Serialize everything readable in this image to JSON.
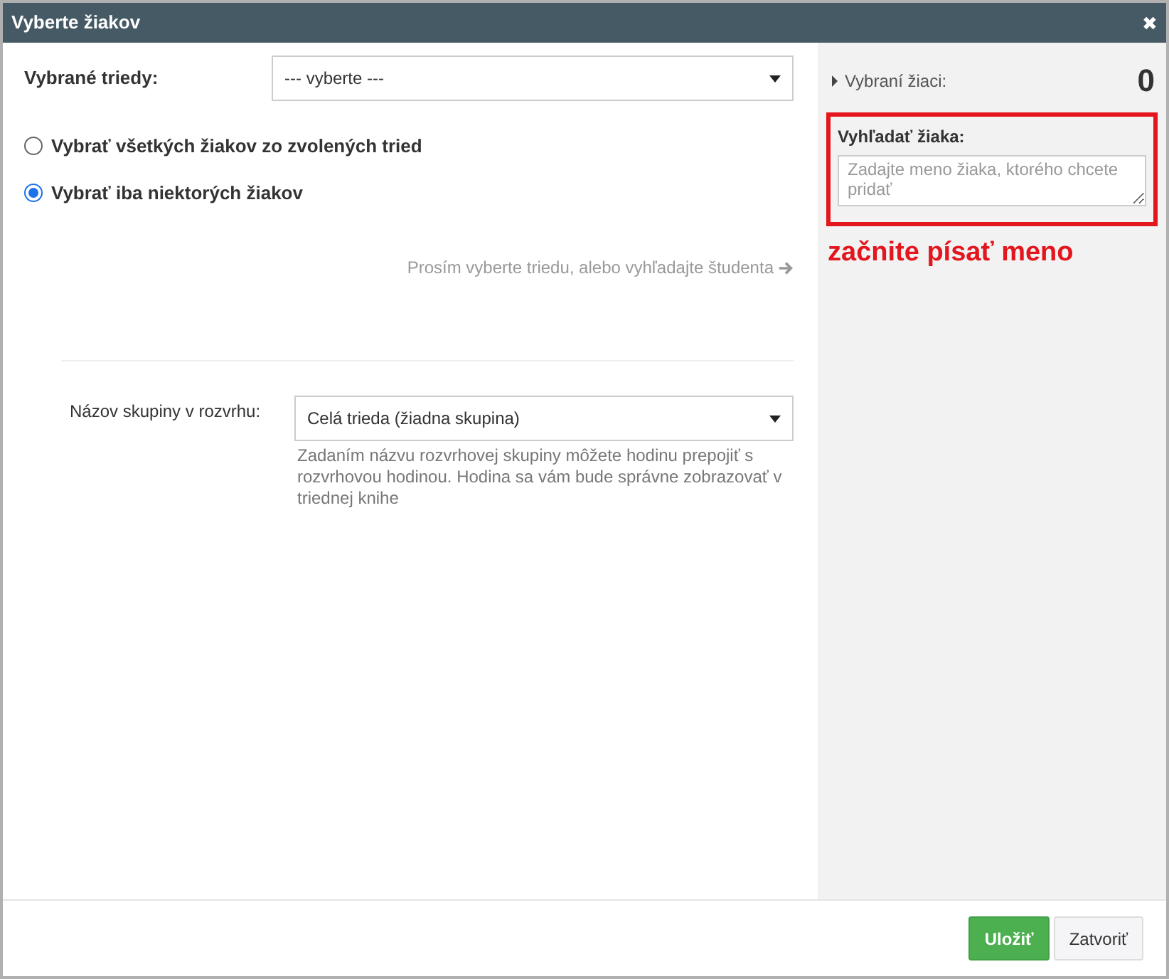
{
  "window": {
    "title": "Vyberte žiakov",
    "close": "✖"
  },
  "classes": {
    "label": "Vybrané triedy:",
    "value": "--- vyberte ---"
  },
  "options": [
    {
      "label": "Vybrať všetkých žiakov zo zvolených tried",
      "selected": false
    },
    {
      "label": "Vybrať iba niektorých žiakov",
      "selected": true
    }
  ],
  "hint": "Prosím vyberte triedu, alebo vyhľadajte študenta",
  "group": {
    "label": "Názov skupiny v rozvrhu:",
    "value": "Celá trieda (žiadna skupina)",
    "help": "Zadaním názvu rozvrhovej skupiny môžete hodinu prepojiť s rozvrhovou hodinou. Hodina sa vám bude správne zobrazovať v triednej knihe"
  },
  "sidebar": {
    "selected_label": "Vybraní žiaci:",
    "selected_count": "0",
    "search_label": "Vyhľadať žiaka:",
    "search_placeholder": "Zadajte meno žiaka, ktorého chcete pridať",
    "annotation": "začnite písať meno"
  },
  "buttons": [
    {
      "label": "Uložiť",
      "kind": "primary"
    },
    {
      "label": "Zatvoriť",
      "kind": "default"
    }
  ]
}
